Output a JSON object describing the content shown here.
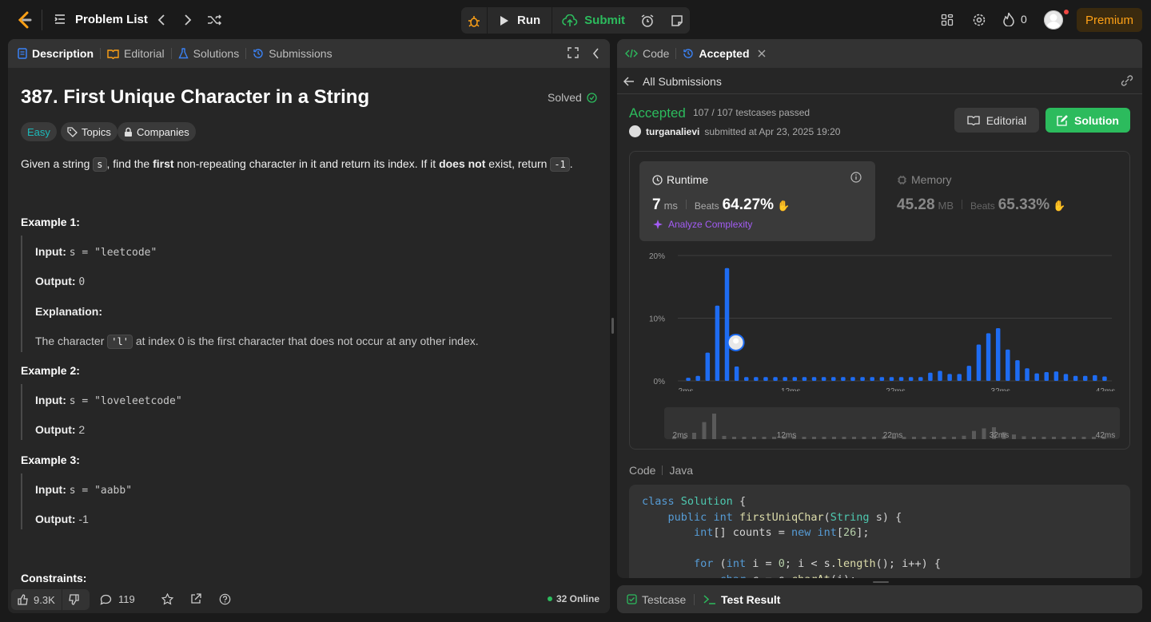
{
  "topbar": {
    "problem_list": "Problem List",
    "run": "Run",
    "submit": "Submit",
    "streak_count": "0",
    "premium": "Premium",
    "colors": {
      "accent": "#ffa116",
      "submit": "#2cbb5d",
      "premium_bg": "#3a2a0f"
    }
  },
  "left": {
    "tabs": [
      "Description",
      "Editorial",
      "Solutions",
      "Submissions"
    ],
    "title": "387. First Unique Character in a String",
    "solved": "Solved",
    "difficulty": "Easy",
    "topics": "Topics",
    "companies": "Companies",
    "desc": {
      "p1": "Given a string ",
      "code_s": "s",
      "p2": ", find the ",
      "b_first": "first",
      "p3": " non-repeating character in it and return its index. If it ",
      "b_not": "does not",
      "p4": " exist, return ",
      "code_neg": "-1",
      "p5": "."
    },
    "examples": [
      {
        "title": "Example 1:",
        "input_label": "Input:",
        "input": "s = \"leetcode\"",
        "output_label": "Output:",
        "output": "0",
        "explanation_label": "Explanation:",
        "explanation_pre": "The character ",
        "explanation_code": "'l'",
        "explanation_post": " at index 0 is the first character that does not occur at any other index."
      },
      {
        "title": "Example 2:",
        "input_label": "Input:",
        "input": "s = \"loveleetcode\"",
        "output_label": "Output:",
        "output": "2"
      },
      {
        "title": "Example 3:",
        "input_label": "Input:",
        "input": "s = \"aabb\"",
        "output_label": "Output:",
        "output": "-1"
      }
    ],
    "constraints": "Constraints:",
    "footer": {
      "likes": "9.3K",
      "comments": "119",
      "online": "32 Online"
    }
  },
  "right": {
    "tabs": [
      "Code",
      "Accepted"
    ],
    "all_submissions": "All Submissions",
    "status": "Accepted",
    "testcases": "107 / 107 testcases passed",
    "user": "turganalievi",
    "submitted": "submitted at Apr 23, 2025 19:20",
    "editorial_btn": "Editorial",
    "solution_btn": "Solution",
    "runtime": {
      "label": "Runtime",
      "value": "7",
      "unit": "ms",
      "beats_label": "Beats",
      "beats": "64.27%",
      "analyze": "Analyze Complexity"
    },
    "memory": {
      "label": "Memory",
      "value": "45.28",
      "unit": "MB",
      "beats_label": "Beats",
      "beats": "65.33%"
    },
    "code_label": "Code",
    "language": "Java",
    "code_lines": [
      "class Solution {",
      "    public int firstUniqChar(String s) {",
      "        int[] counts = new int[26];",
      "",
      "        for (int i = 0; i < s.length(); i++) {",
      "            char c = s.charAt(i);"
    ]
  },
  "bottom": {
    "testcase": "Testcase",
    "test_result": "Test Result"
  },
  "chart_data": {
    "type": "bar",
    "x": [
      2,
      3,
      4,
      5,
      6,
      7,
      8,
      9,
      10,
      11,
      12,
      13,
      14,
      15,
      16,
      17,
      18,
      19,
      20,
      21,
      22,
      23,
      24,
      25,
      26,
      27,
      28,
      29,
      30,
      31,
      32,
      33,
      34,
      35,
      36,
      37,
      38,
      39,
      40,
      41,
      42,
      43
    ],
    "values": [
      0.5,
      0.8,
      4.5,
      12,
      18,
      2.3,
      0.6,
      0.6,
      0.6,
      0.6,
      0.6,
      0.6,
      0.6,
      0.6,
      0.6,
      0.6,
      0.6,
      0.6,
      0.6,
      0.6,
      0.6,
      0.6,
      0.6,
      0.6,
      0.6,
      1.3,
      1.6,
      1.1,
      1.1,
      2.4,
      5.8,
      7.6,
      8.4,
      5.0,
      3.3,
      2.0,
      1.2,
      1.4,
      1.5,
      1.1,
      0.8,
      0.8,
      0.9,
      0.7
    ],
    "xticks": [
      "2ms",
      "12ms",
      "22ms",
      "32ms",
      "42ms"
    ],
    "yticks": [
      "20%",
      "10%",
      "0%"
    ],
    "ylim": [
      0,
      20
    ],
    "highlight_x": 7,
    "bar_color": "#1e6cf2"
  }
}
